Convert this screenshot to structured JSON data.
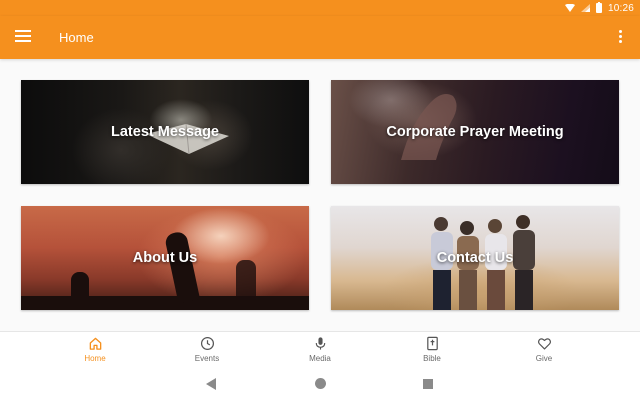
{
  "status_bar": {
    "time": "10:26"
  },
  "app_bar": {
    "title": "Home"
  },
  "cards": [
    {
      "label": "Latest Message"
    },
    {
      "label": "Corporate Prayer Meeting"
    },
    {
      "label": "About Us"
    },
    {
      "label": "Contact Us"
    }
  ],
  "bottom_nav": {
    "items": [
      {
        "label": "Home",
        "icon": "home-icon",
        "active": true
      },
      {
        "label": "Events",
        "icon": "clock-icon",
        "active": false
      },
      {
        "label": "Media",
        "icon": "microphone-icon",
        "active": false
      },
      {
        "label": "Bible",
        "icon": "bible-icon",
        "active": false
      },
      {
        "label": "Give",
        "icon": "heart-icon",
        "active": false
      }
    ]
  },
  "colors": {
    "primary": "#f5901e",
    "nav_inactive": "#6a6a6a",
    "nav_active": "#f5901e"
  }
}
